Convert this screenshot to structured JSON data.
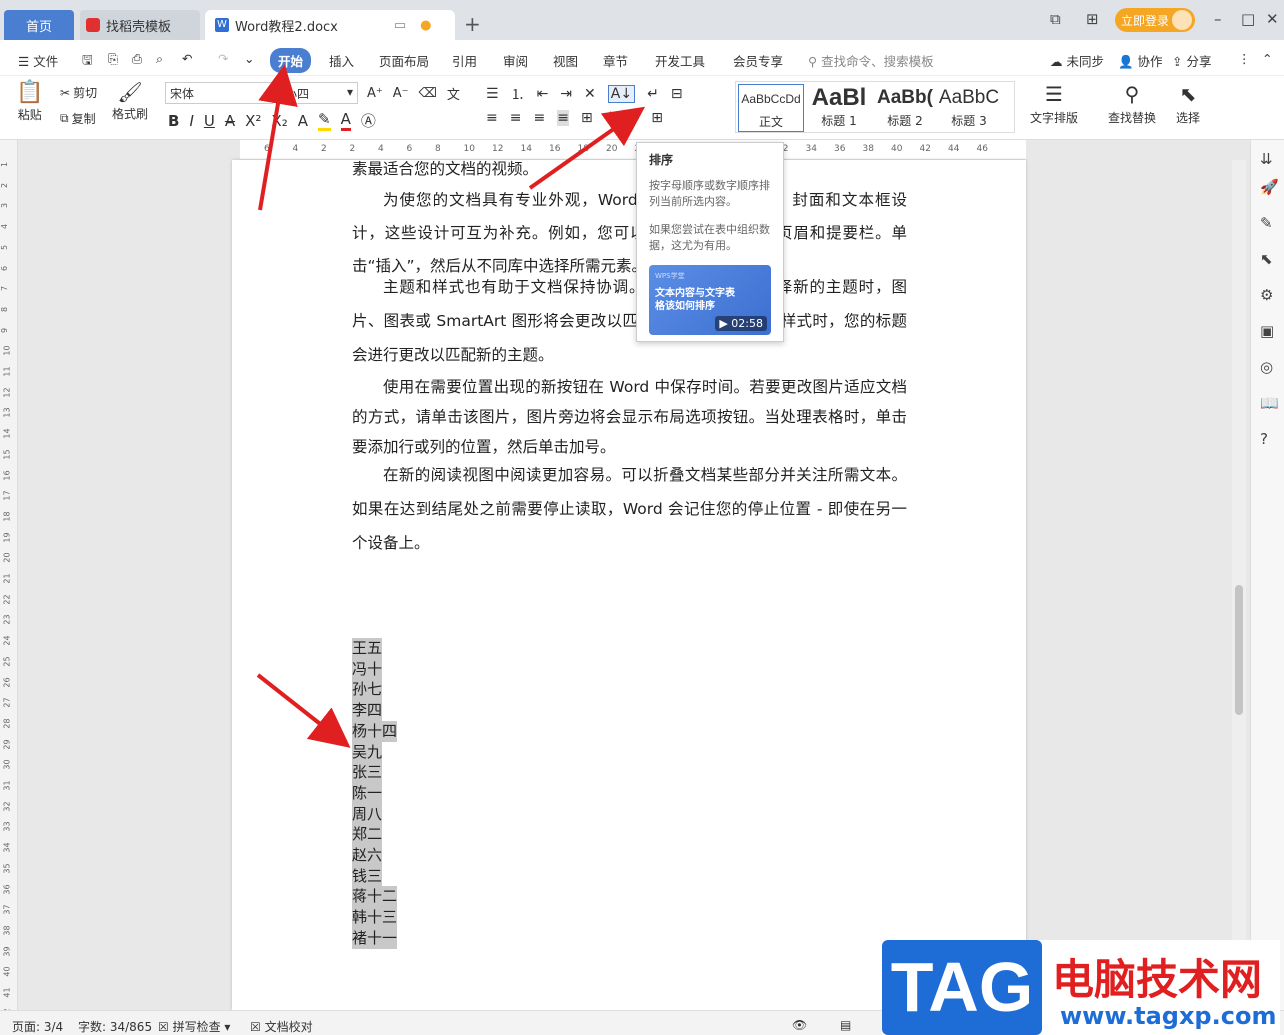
{
  "tabs": {
    "home": "首页",
    "template": "找稻壳模板",
    "doc": "Word教程2.docx"
  },
  "login": "立即登录",
  "menu": {
    "file": "文件",
    "items": [
      "开始",
      "插入",
      "页面布局",
      "引用",
      "审阅",
      "视图",
      "章节",
      "开发工具",
      "会员专享"
    ],
    "search_placeholder": "查找命令、搜索模板",
    "sync": "未同步",
    "collab": "协作",
    "share": "分享"
  },
  "toolbar": {
    "paste": "粘贴",
    "cut": "剪切",
    "copy": "复制",
    "format_painter": "格式刷",
    "font": "宋体",
    "size": "小四",
    "styles": [
      {
        "preview": "AaBbCcDd",
        "label": "正文"
      },
      {
        "preview": "AaBl",
        "label": "标题 1"
      },
      {
        "preview": "AaBb(",
        "label": "标题 2"
      },
      {
        "preview": "AaBbC",
        "label": "标题 3"
      }
    ],
    "text_layout": "文字排版",
    "find_replace": "查找替换",
    "select": "选择"
  },
  "ruler": [
    "6",
    "4",
    "2",
    "2",
    "4",
    "6",
    "8",
    "10",
    "12",
    "14",
    "16",
    "18",
    "20",
    "22",
    "24",
    "26",
    "28",
    "30",
    "32",
    "34",
    "36",
    "38",
    "40",
    "42",
    "44",
    "46"
  ],
  "document": {
    "lines_top": "素最适合您的文档的视频。",
    "p1": "为使您的文档具有专业外观，Word 提供了页眉、页脚、封面和文本框设计，这些设计可互为补充。例如，您可以添加匹配的封面、页眉和提要栏。单击“插入”，然后从不同库中选择所需元素。",
    "p2": "主题和样式也有助于文档保持协调。当您单击设计并选择新的主题时，图片、图表或 SmartArt 图形将会更改以匹配新的主题。当应用样式时，您的标题会进行更改以匹配新的主题。",
    "p3": "使用在需要位置出现的新按钮在 Word 中保存时间。若要更改图片适应文档的方式，请单击该图片，图片旁边将会显示布局选项按钮。当处理表格时，单击要添加行或列的位置，然后单击加号。",
    "p4": "在新的阅读视图中阅读更加容易。可以折叠文档某些部分并关注所需文本。如果在达到结尾处之前需要停止读取，Word 会记住您的停止位置 - 即使在另一个设备上。",
    "names": [
      "王五",
      "冯十",
      "孙七",
      "李四",
      "杨十四",
      "吴九",
      "张三",
      "陈一",
      "周八",
      "郑二",
      "赵六",
      "钱三",
      "蒋十二",
      "韩十三",
      "褚十一"
    ]
  },
  "tooltip": {
    "title": "排序",
    "desc": "按字母顺序或数字顺序排列当前所选内容。",
    "tip": "如果您尝试在表中组织数据，这尤为有用。",
    "video_brand": "WPS学堂",
    "video_title": "文本内容与文字表格该如何排序",
    "duration": "02:58"
  },
  "status": {
    "page": "页面: 3/4",
    "words": "字数: 34/865",
    "spell": "拼写检查",
    "proof": "文档校对"
  },
  "watermark": {
    "tag": "TAG",
    "title": "电脑技术网",
    "url": "www.tagxp.com"
  },
  "colors": {
    "accent": "#4a7ed1",
    "arrow": "#e02020",
    "login": "#f5a623"
  }
}
